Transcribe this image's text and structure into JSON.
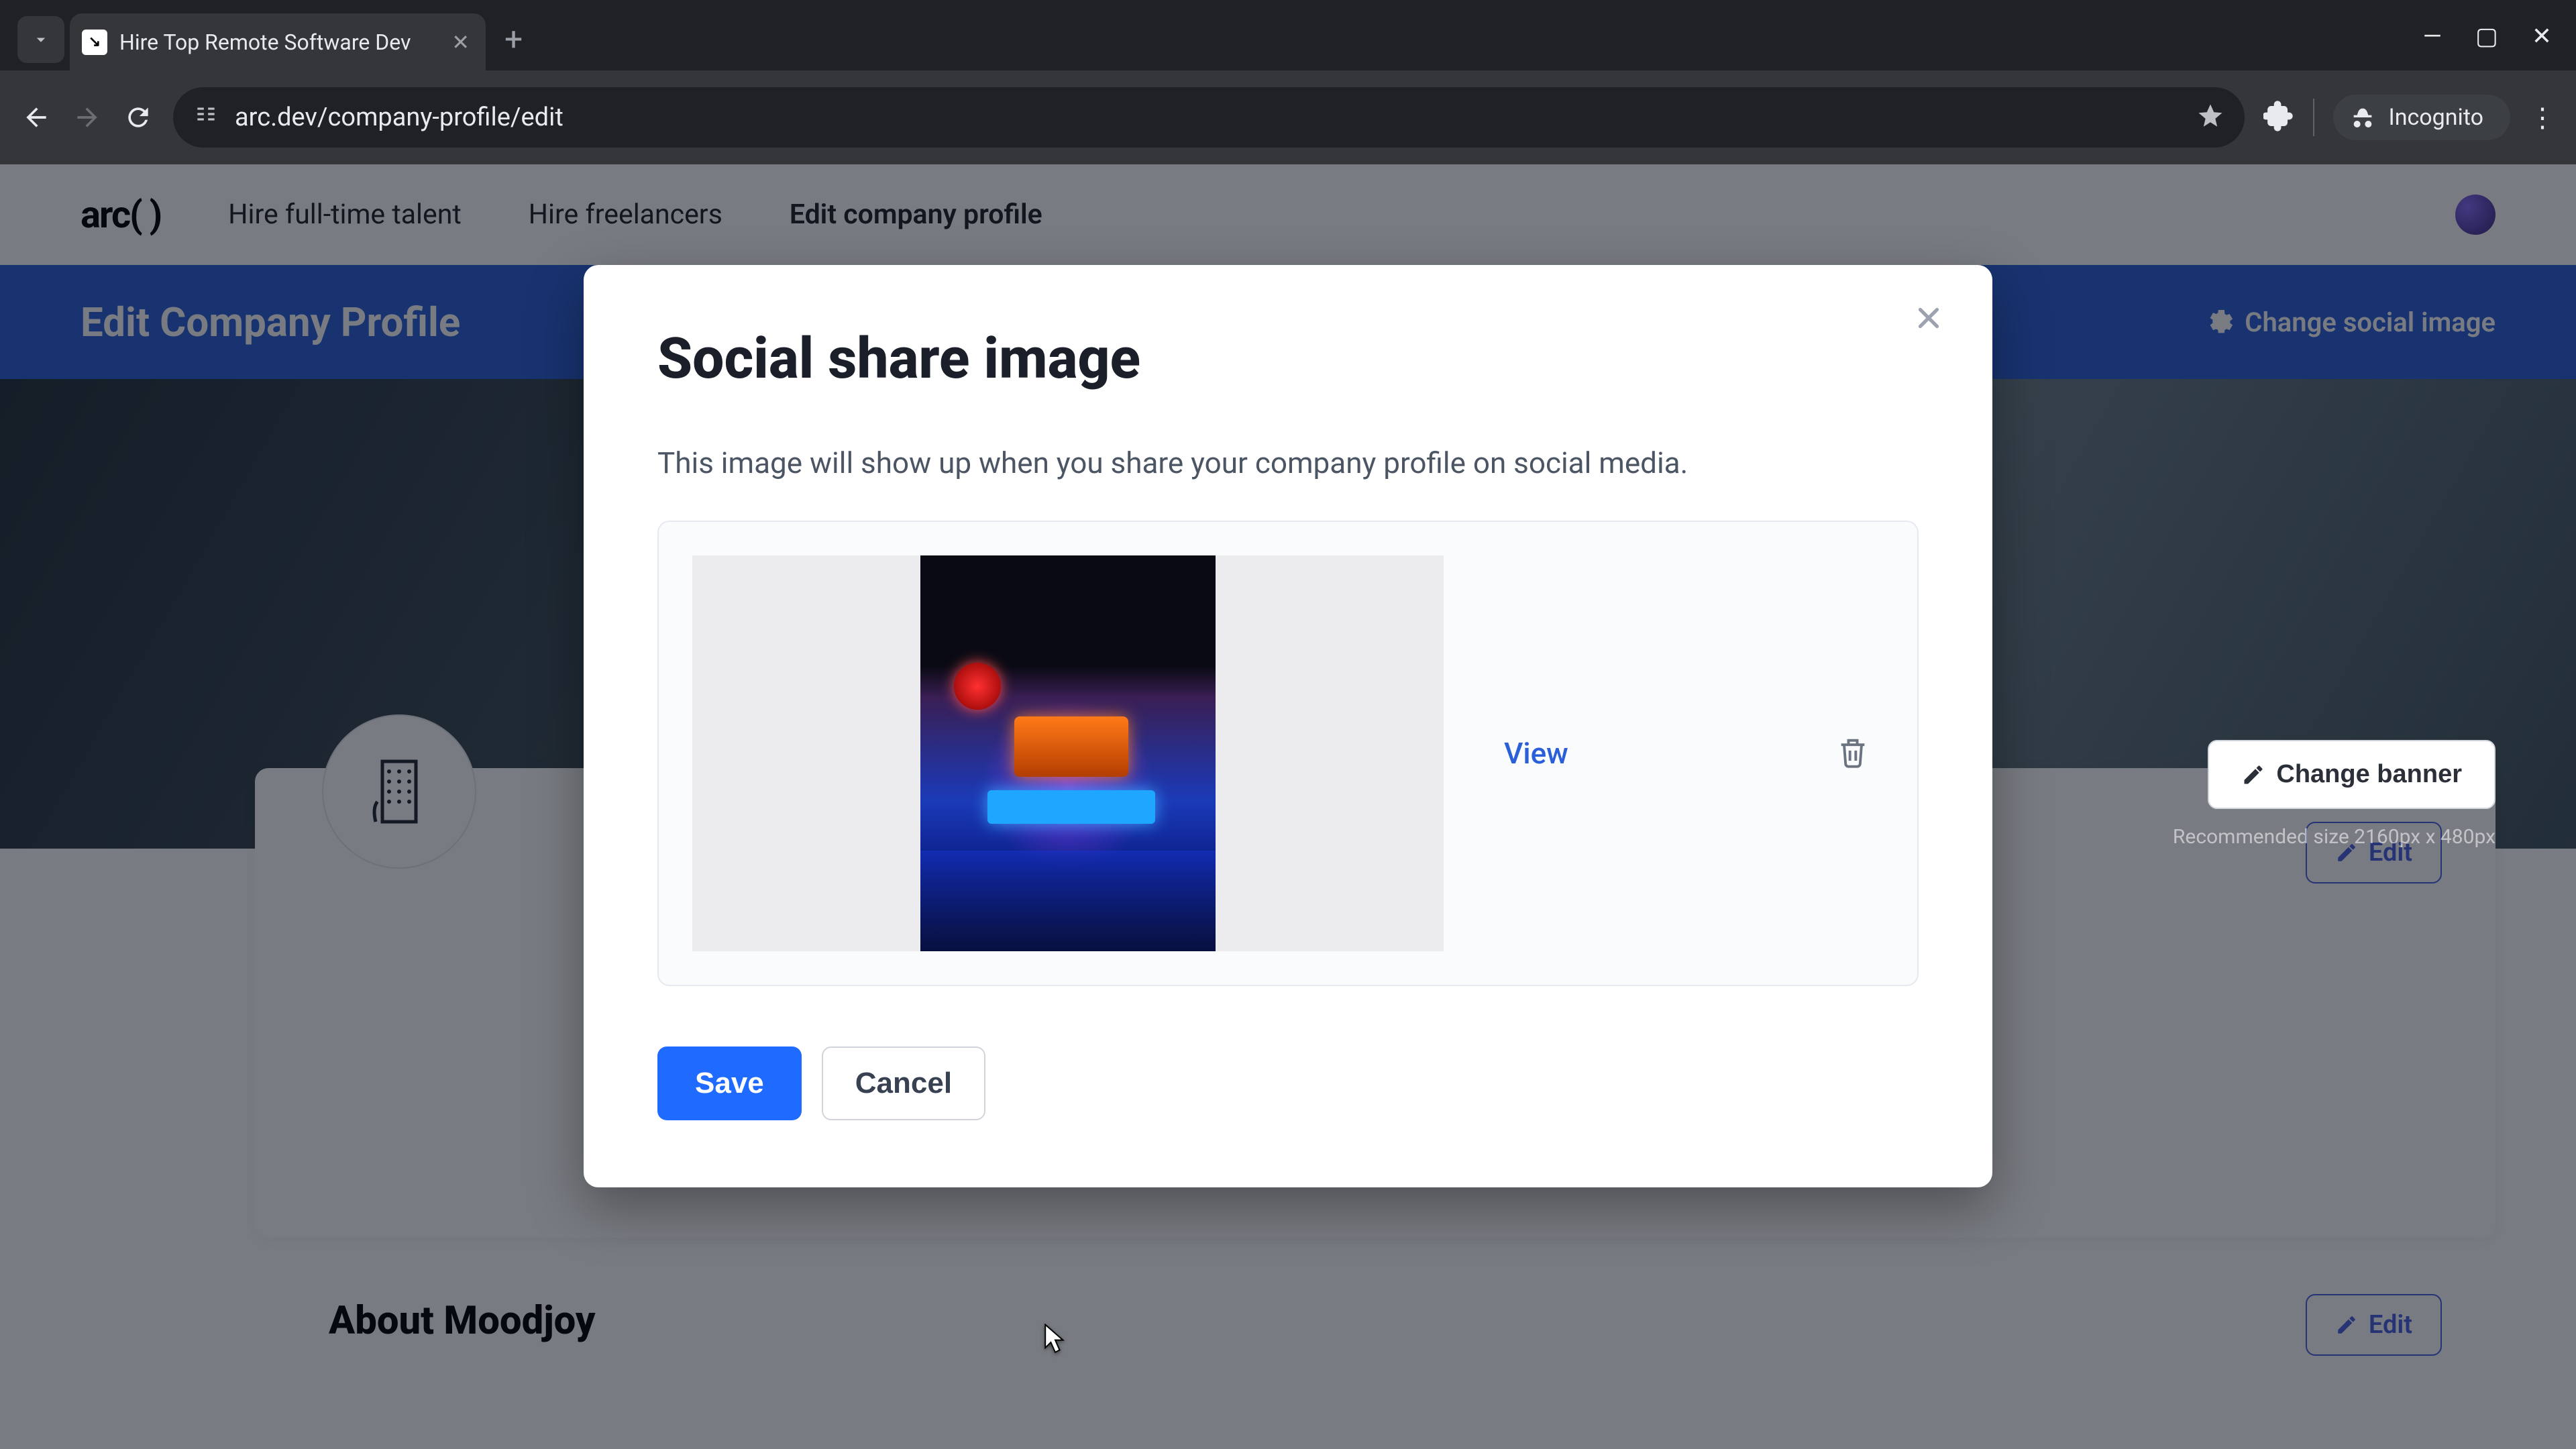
{
  "browser": {
    "tab_title": "Hire Top Remote Software Dev",
    "url": "arc.dev/company-profile/edit",
    "incognito_label": "Incognito"
  },
  "topnav": {
    "logo": "arc( )",
    "links": {
      "fulltime": "Hire full-time talent",
      "freelance": "Hire freelancers",
      "edit": "Edit company profile"
    }
  },
  "blue_bar": {
    "title": "Edit Company Profile",
    "change_social": "Change social image"
  },
  "banner": {
    "change_btn": "Change banner",
    "hint": "Recommended size 2160px x 480px"
  },
  "card": {
    "edit_btn": "Edit"
  },
  "about": {
    "heading": "About Moodjoy"
  },
  "modal": {
    "title": "Social share image",
    "description": "This image will show up when you share your company profile on social media.",
    "view_label": "View",
    "save_label": "Save",
    "cancel_label": "Cancel"
  }
}
